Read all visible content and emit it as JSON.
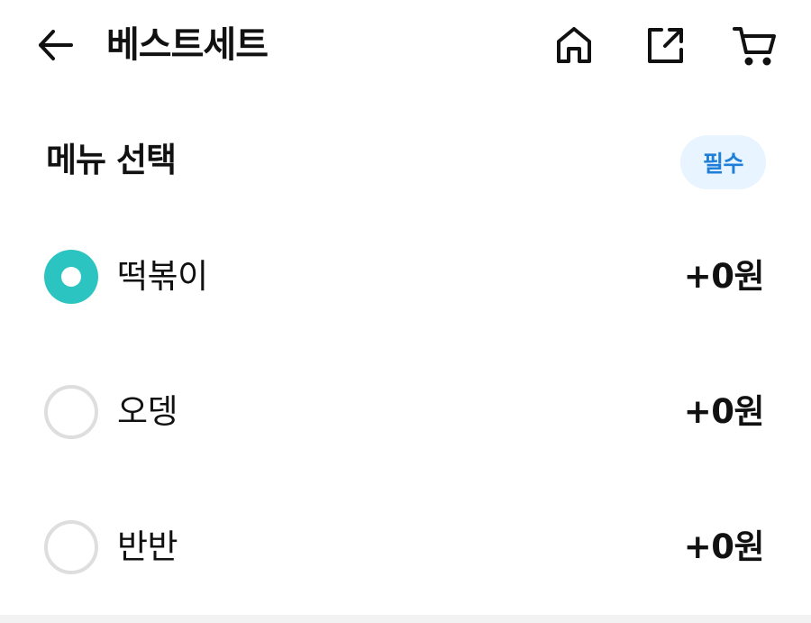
{
  "header": {
    "title": "베스트세트",
    "icons": {
      "back": "arrow-left-icon",
      "home": "home-icon",
      "share": "share-icon",
      "cart": "cart-icon"
    }
  },
  "section": {
    "title": "메뉴 선택",
    "badge": "필수",
    "accent_color": "#2cc4c0",
    "badge_color": "#1f7fd8"
  },
  "options": [
    {
      "label": "떡볶이",
      "price": "+0원",
      "selected": true
    },
    {
      "label": "오뎅",
      "price": "+0원",
      "selected": false
    },
    {
      "label": "반반",
      "price": "+0원",
      "selected": false
    }
  ]
}
